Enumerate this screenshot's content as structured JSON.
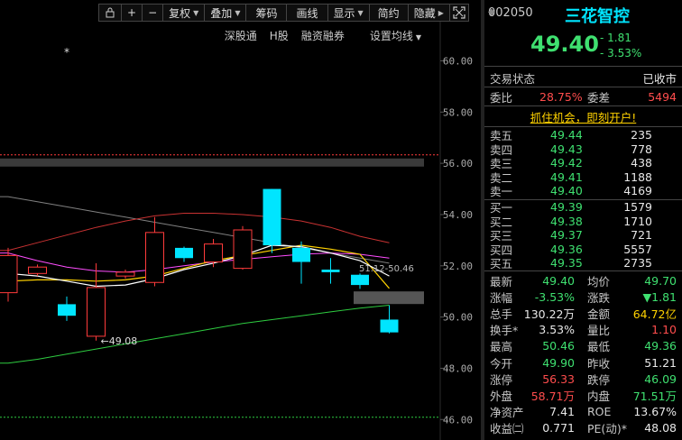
{
  "toolbar": {
    "buttons": [
      {
        "label": "",
        "icon": "lock-icon",
        "name": "lock-button"
      },
      {
        "label": "+",
        "icon": "",
        "name": "zoom-in-button"
      },
      {
        "label": "−",
        "icon": "",
        "name": "zoom-out-button"
      },
      {
        "label": "复权",
        "dropdown": true,
        "name": "adjust-button"
      },
      {
        "label": "叠加",
        "dropdown": true,
        "name": "overlay-button"
      },
      {
        "label": "筹码",
        "dropdown": false,
        "name": "chips-button"
      },
      {
        "label": "画线",
        "dropdown": false,
        "name": "draw-line-button"
      },
      {
        "label": "显示",
        "dropdown": true,
        "name": "display-button"
      },
      {
        "label": "简约",
        "dropdown": false,
        "name": "simple-button"
      },
      {
        "label": "隐藏",
        "dropdown": false,
        "name": "hide-button"
      }
    ],
    "expand_icon": "expand-icon"
  },
  "subbar": {
    "shenzhen": "深股通",
    "hshare": "H股",
    "margin": "融资融券",
    "ma_settings": "设置均线"
  },
  "chart": {
    "y_labels": [
      "60.00",
      "58.00",
      "56.00",
      "54.00",
      "52.00",
      "50.00",
      "48.00",
      "46.00"
    ],
    "low_marker": "←49.08",
    "ma_annot": "51.12-50.46",
    "star": "*",
    "colors": {
      "up": "#ff3b3b",
      "down": "#00e5ff",
      "ma5": "#ffffff",
      "ma10": "#ffd200",
      "ma20": "#ff4dff",
      "ma60": "#c83232",
      "ma120": "#2ecc40",
      "ma250": "#808080"
    }
  },
  "chart_data": {
    "type": "candlestick",
    "ylim": [
      45.2,
      61.6
    ],
    "candles": [
      {
        "o": 50.95,
        "c": 52.4,
        "h": 52.7,
        "l": 50.6
      },
      {
        "o": 51.7,
        "c": 51.95,
        "h": 52.05,
        "l": 51.6
      },
      {
        "o": 50.5,
        "c": 50.05,
        "h": 50.8,
        "l": 49.85
      },
      {
        "o": 49.25,
        "c": 51.15,
        "h": 52.1,
        "l": 49.08
      },
      {
        "o": 51.6,
        "c": 51.75,
        "h": 51.85,
        "l": 51.5
      },
      {
        "o": 51.35,
        "c": 53.3,
        "h": 53.9,
        "l": 51.2
      },
      {
        "o": 52.7,
        "c": 52.3,
        "h": 52.75,
        "l": 52.15
      },
      {
        "o": 52.15,
        "c": 52.85,
        "h": 53.05,
        "l": 51.95
      },
      {
        "o": 51.9,
        "c": 53.4,
        "h": 53.55,
        "l": 51.85
      },
      {
        "o": 55.0,
        "c": 52.8,
        "h": 55.0,
        "l": 52.5
      },
      {
        "o": 52.7,
        "c": 52.15,
        "h": 52.95,
        "l": 51.3
      },
      {
        "o": 51.85,
        "c": 51.75,
        "h": 52.3,
        "l": 51.3
      },
      {
        "o": 51.65,
        "c": 51.25,
        "h": 51.7,
        "l": 51.1
      },
      {
        "o": 49.9,
        "c": 49.4,
        "h": 50.46,
        "l": 49.36
      }
    ],
    "ma_lines": {
      "ma5": [
        51.7,
        51.6,
        51.4,
        51.2,
        51.25,
        51.5,
        51.85,
        52.1,
        52.4,
        52.8,
        52.75,
        52.5,
        52.2,
        51.6
      ],
      "ma10": [
        51.4,
        51.45,
        51.45,
        51.4,
        51.45,
        51.6,
        51.9,
        52.2,
        52.4,
        52.6,
        52.8,
        52.65,
        52.45,
        51.12
      ],
      "ma20": [
        52.5,
        52.2,
        51.95,
        51.8,
        51.75,
        51.85,
        52.0,
        52.15,
        52.25,
        52.35,
        52.45,
        52.5,
        52.45,
        52.3
      ],
      "ma60": [
        52.6,
        52.9,
        53.2,
        53.5,
        53.75,
        53.95,
        54.05,
        54.05,
        54.0,
        53.9,
        53.75,
        53.5,
        53.15,
        52.9
      ],
      "ma120": [
        48.2,
        48.35,
        48.55,
        48.75,
        48.95,
        49.15,
        49.35,
        49.55,
        49.75,
        49.9,
        50.05,
        50.2,
        50.35,
        50.46
      ],
      "ma250": [
        54.7,
        54.5,
        54.3,
        54.1,
        53.9,
        53.7,
        53.5,
        53.3,
        53.1,
        52.9,
        52.7,
        52.5,
        52.3,
        52.1
      ]
    },
    "limit_up_line": 56.33,
    "limit_down_line": 46.09
  },
  "panel": {
    "code": "002050",
    "name": "三花智控",
    "price": "49.40",
    "change": "- 1.81",
    "change_pct": "- 3.53%",
    "status_label": "交易状态",
    "status_value": "已收市",
    "weibi_label": "委比",
    "weibi_value": "28.75%",
    "weicha_label": "委差",
    "weicha_value": "5494",
    "promo": "抓住机会，即刻开户!",
    "asks": [
      {
        "label": "卖五",
        "price": "49.44",
        "vol": "235"
      },
      {
        "label": "卖四",
        "price": "49.43",
        "vol": "778"
      },
      {
        "label": "卖三",
        "price": "49.42",
        "vol": "438"
      },
      {
        "label": "卖二",
        "price": "49.41",
        "vol": "1188"
      },
      {
        "label": "卖一",
        "price": "49.40",
        "vol": "4169"
      }
    ],
    "bids": [
      {
        "label": "买一",
        "price": "49.39",
        "vol": "1579"
      },
      {
        "label": "买二",
        "price": "49.38",
        "vol": "1710"
      },
      {
        "label": "买三",
        "price": "49.37",
        "vol": "721"
      },
      {
        "label": "买四",
        "price": "49.36",
        "vol": "5557"
      },
      {
        "label": "买五",
        "price": "49.35",
        "vol": "2735"
      }
    ],
    "stats": [
      {
        "l1": "最新",
        "v1": "49.40",
        "c1": "green",
        "l2": "均价",
        "v2": "49.70",
        "c2": "green"
      },
      {
        "l1": "涨幅",
        "v1": "-3.53%",
        "c1": "green",
        "l2": "涨跌",
        "v2": "▼1.81",
        "c2": "green"
      },
      {
        "l1": "总手",
        "v1": "130.22万",
        "c1": "white",
        "l2": "金额",
        "v2": "64.72亿",
        "c2": "yellow"
      },
      {
        "l1": "换手*",
        "v1": "3.53%",
        "c1": "white",
        "l2": "量比",
        "v2": "1.10",
        "c2": "red"
      },
      {
        "l1": "最高",
        "v1": "50.46",
        "c1": "green",
        "l2": "最低",
        "v2": "49.36",
        "c2": "green"
      },
      {
        "l1": "今开",
        "v1": "49.90",
        "c1": "green",
        "l2": "昨收",
        "v2": "51.21",
        "c2": "white"
      },
      {
        "l1": "涨停",
        "v1": "56.33",
        "c1": "red",
        "l2": "跌停",
        "v2": "46.09",
        "c2": "green"
      },
      {
        "l1": "外盘",
        "v1": "58.71万",
        "c1": "red",
        "l2": "内盘",
        "v2": "71.51万",
        "c2": "green"
      },
      {
        "l1": "净资产",
        "v1": "7.41",
        "c1": "white",
        "l2": "ROE",
        "v2": "13.67%",
        "c2": "white"
      },
      {
        "l1": "收益㈡",
        "v1": "0.771",
        "c1": "white",
        "l2": "PE(动)*",
        "v2": "48.08",
        "c2": "white"
      }
    ]
  }
}
